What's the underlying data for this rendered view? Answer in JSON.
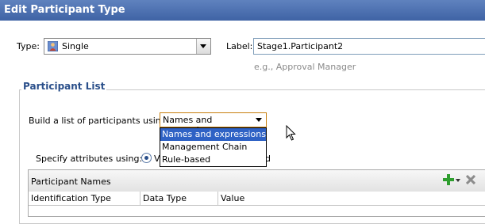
{
  "window": {
    "title": "Edit Participant Type"
  },
  "type_field": {
    "label": "Type:",
    "value": "Single",
    "icon": "participant-icon"
  },
  "label_field": {
    "label": "Label:",
    "value": "Stage1.Participant2",
    "hint": "e.g., Approval Manager"
  },
  "participant_list": {
    "section_title": "Participant List",
    "build_label": "Build a list of participants using:",
    "build_value": "Names and expressions",
    "options": [
      "Names and expressions",
      "Management Chain",
      "Rule-based"
    ],
    "selected_option_index": 0,
    "specify_label": "Specify attributes using:",
    "radio_visible_prefix": "V",
    "radio_visible_suffix": "d"
  },
  "table": {
    "title": "Participant Names",
    "add_icon": "plus-icon",
    "delete_icon": "delete-x-icon",
    "columns": [
      "Identification Type",
      "Data Type",
      "Value"
    ]
  },
  "colors": {
    "titlebar": "#4a6fb0",
    "section_title": "#2a4f8a",
    "selection": "#2f62c5",
    "focus_border": "#c77f0e"
  }
}
